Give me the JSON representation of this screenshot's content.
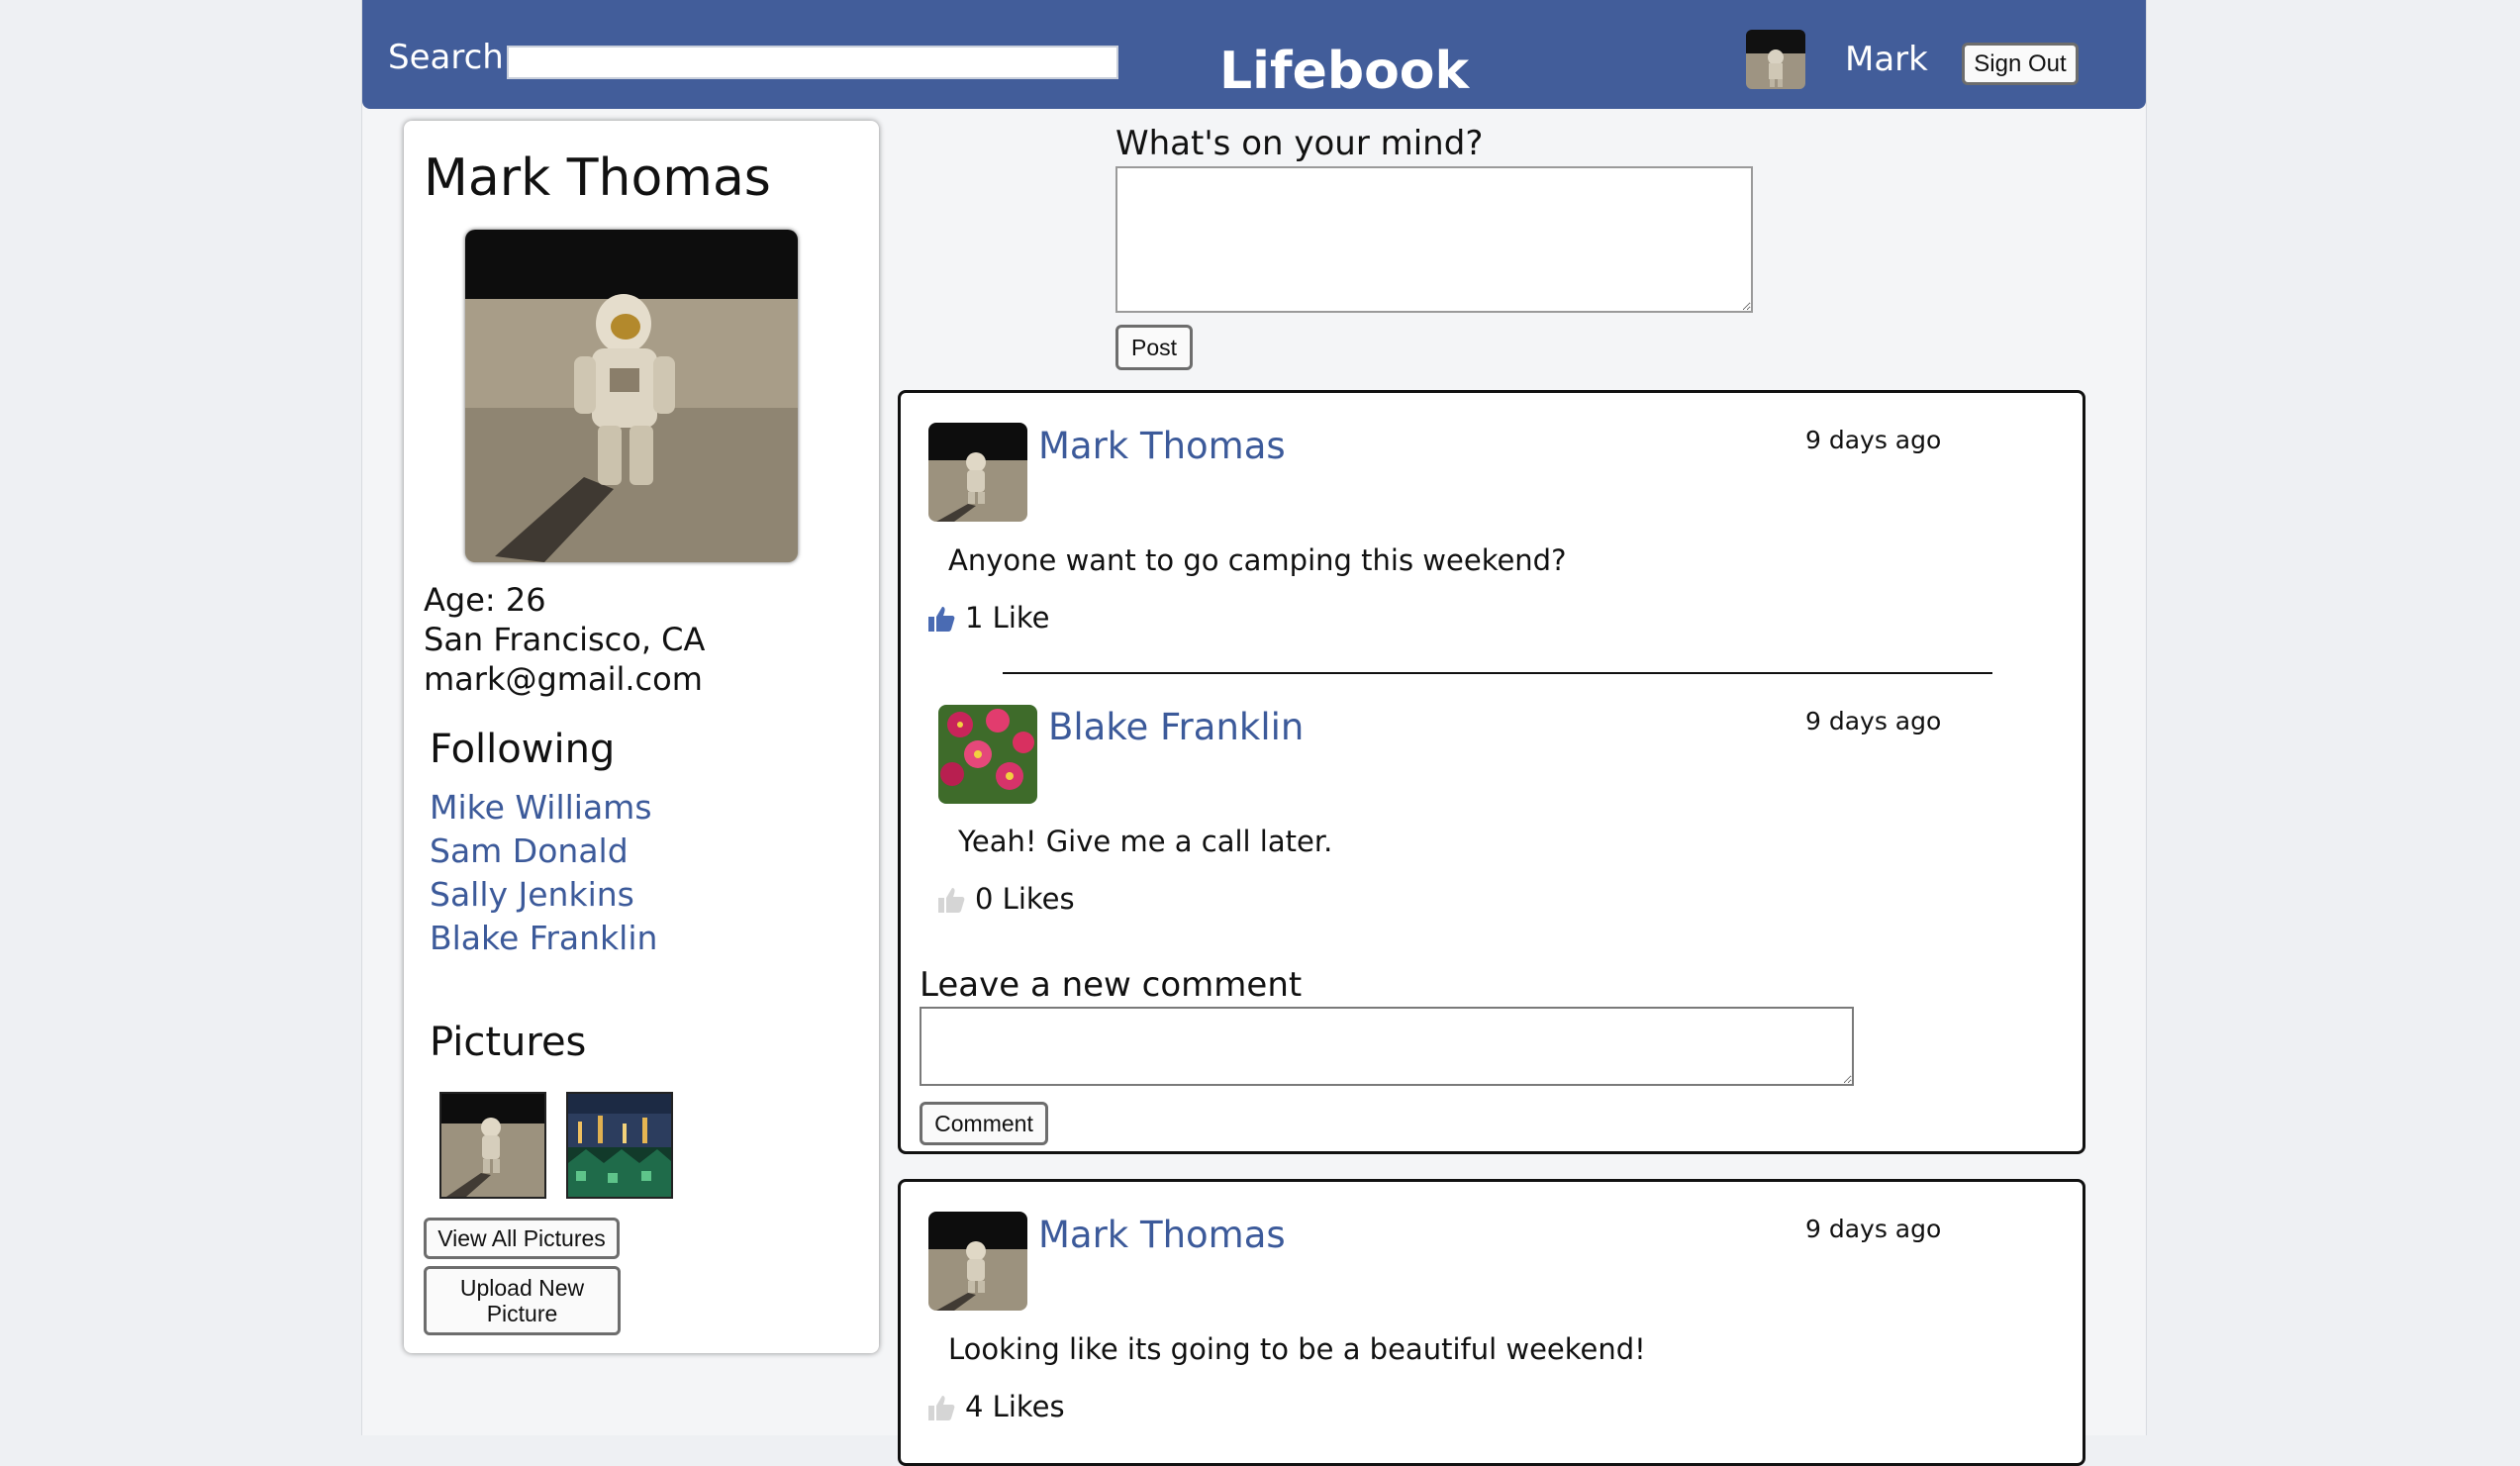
{
  "header": {
    "search_label": "Search:",
    "search_value": "",
    "brand": "Lifebook",
    "user_name": "Mark",
    "sign_out": "Sign Out"
  },
  "profile": {
    "name": "Mark Thomas",
    "age": "Age: 26",
    "location": "San Francisco, CA",
    "email": "mark@gmail.com",
    "following_title": "Following",
    "following": [
      "Mike Williams",
      "Sam Donald",
      "Sally Jenkins",
      "Blake Franklin"
    ],
    "pictures_title": "Pictures",
    "view_all": "View All Pictures",
    "upload_line1": "Upload New",
    "upload_line2": "Picture"
  },
  "composer": {
    "label": "What's on your mind?",
    "value": "",
    "post_button": "Post"
  },
  "posts": [
    {
      "author": "Mark Thomas",
      "time": "9 days ago",
      "text": "Anyone want to go camping this weekend?",
      "likes": "1 Like",
      "liked": true,
      "comments": [
        {
          "author": "Blake Franklin",
          "time": "9 days ago",
          "text": "Yeah! Give me a call later.",
          "likes": "0 Likes",
          "liked": false
        }
      ],
      "comment_label": "Leave a new comment",
      "comment_value": "",
      "comment_button": "Comment"
    },
    {
      "author": "Mark Thomas",
      "time": "9 days ago",
      "text": "Looking like its going to be a beautiful weekend!",
      "likes": "4 Likes",
      "liked": false
    }
  ],
  "colors": {
    "header_bg": "#425d9a",
    "link": "#3c5a9a",
    "like_active": "#4a6bb3",
    "like_inactive": "#d5d5d5"
  }
}
